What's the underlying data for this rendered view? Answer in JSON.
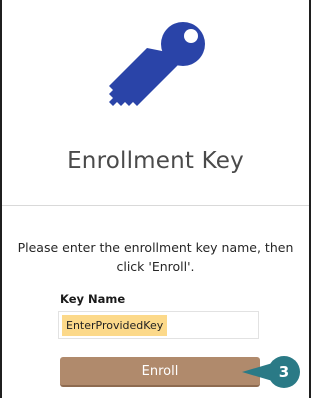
{
  "header": {
    "icon": "key-icon",
    "title": "Enrollment Key"
  },
  "form": {
    "instructions": "Please enter the enrollment key name, then click 'Enroll'.",
    "key_name_label": "Key Name",
    "key_name_value": "EnterProvidedKey",
    "enroll_label": "Enroll"
  },
  "callout": {
    "number": "3",
    "color": "#2a7a86"
  },
  "colors": {
    "key_icon": "#2a44a8",
    "button": "#b08a6c",
    "input_highlight": "#fcd98a"
  }
}
